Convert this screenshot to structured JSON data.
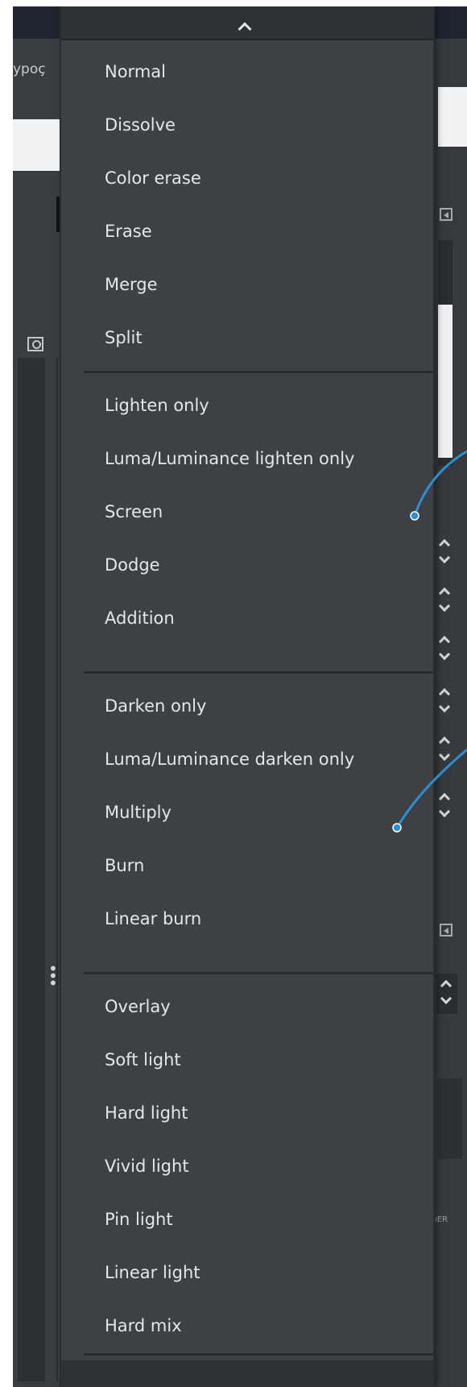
{
  "background_panel": {
    "left_label": "ypoç",
    "right_label": "ıER"
  },
  "blend_menu": {
    "groups": [
      [
        "Normal",
        "Dissolve",
        "Color erase",
        "Erase",
        "Merge",
        "Split"
      ],
      [
        "Lighten only",
        "Luma/Luminance lighten only",
        "Screen",
        "Dodge",
        "Addition"
      ],
      [
        "Darken only",
        "Luma/Luminance darken only",
        "Multiply",
        "Burn",
        "Linear burn"
      ],
      [
        "Overlay",
        "Soft light",
        "Hard light",
        "Vivid light",
        "Pin light",
        "Linear light",
        "Hard mix"
      ]
    ]
  },
  "colors": {
    "menu_background": "#3e4043",
    "menu_text": "#e6e6e6",
    "separator": "#2a2b2e",
    "connector_wire": "#2b8fd6"
  },
  "icons": {
    "scroll_up": "chevron-up-icon",
    "search": "search-icon",
    "collapse": "collapse-panel-icon",
    "drag_handle": "vertical-dots-icon"
  }
}
